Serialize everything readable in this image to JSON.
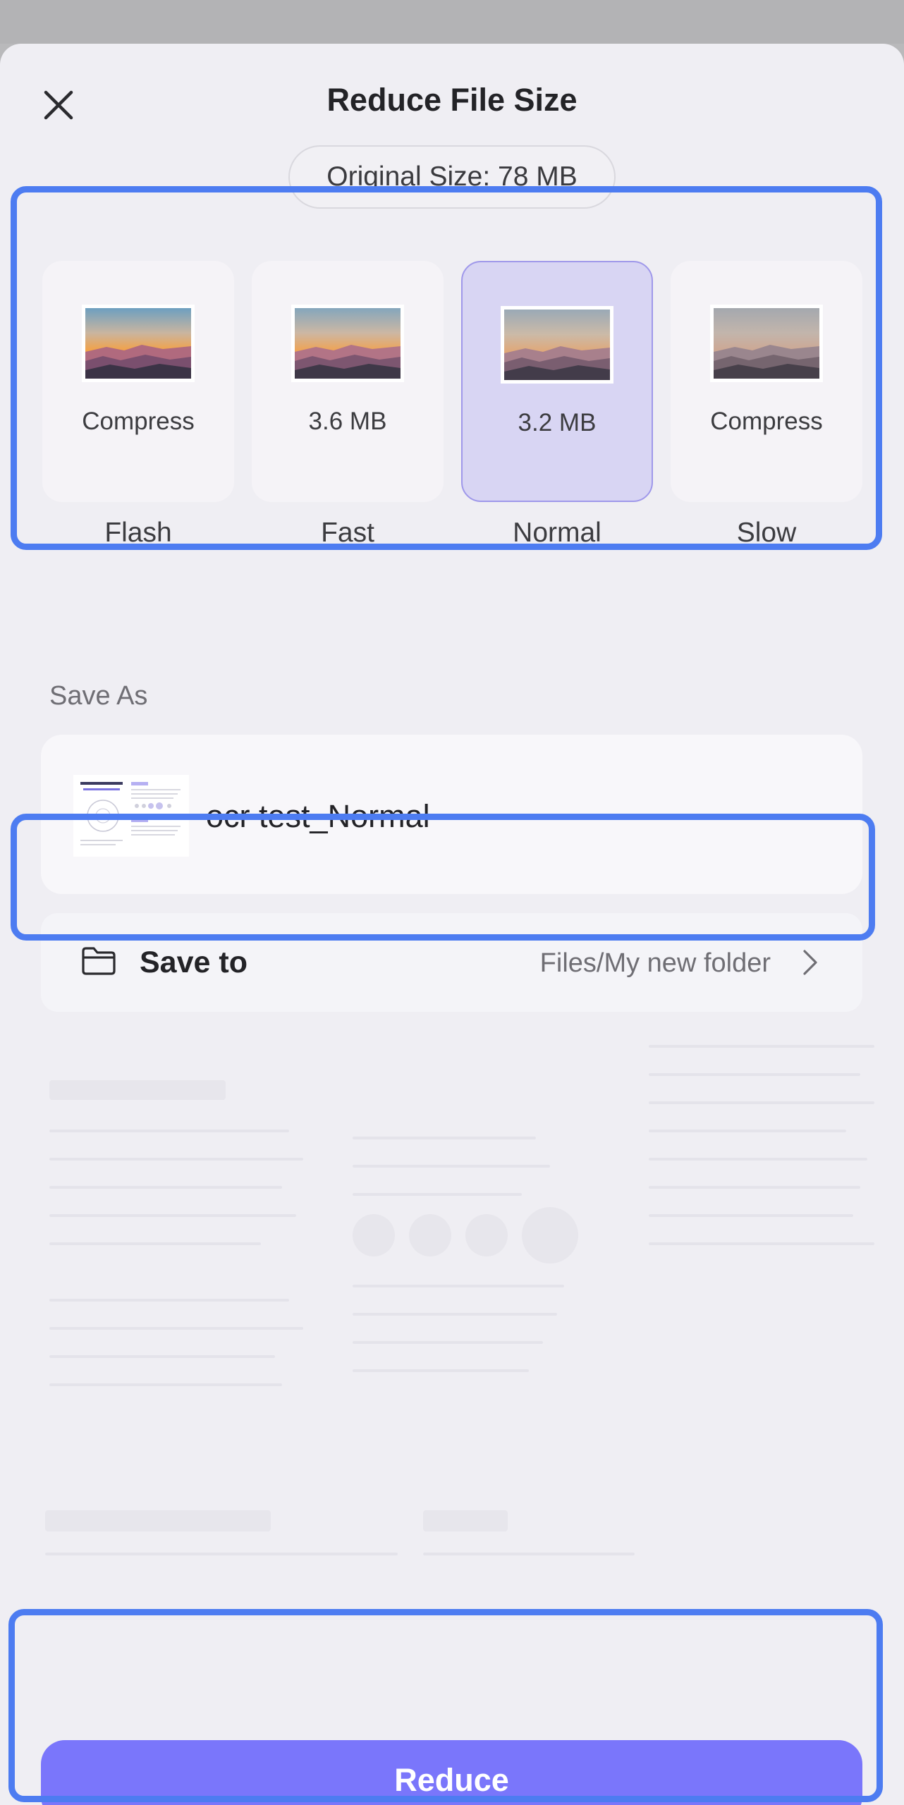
{
  "dialog": {
    "title": "Reduce File Size",
    "original_size": "Original Size: 78 MB"
  },
  "options": [
    {
      "size": "Compress",
      "label": "Flash",
      "selected": false
    },
    {
      "size": "3.6 MB",
      "label": "Fast",
      "selected": false
    },
    {
      "size": "3.2 MB",
      "label": "Normal",
      "selected": true
    },
    {
      "size": "Compress",
      "label": "Slow",
      "selected": false
    }
  ],
  "save_as": {
    "heading": "Save As",
    "file_name": "ocr test_Normal",
    "thumbnail_icon": "document-thumbnail"
  },
  "save_to": {
    "label": "Save to",
    "path": "Files/My new folder",
    "icon": "folder-icon"
  },
  "action": {
    "reduce_label": "Reduce"
  },
  "colors": {
    "accent": "#7a76fb",
    "selected_card": "#d8d5f3",
    "highlight_outline": "#4d7cf1"
  }
}
